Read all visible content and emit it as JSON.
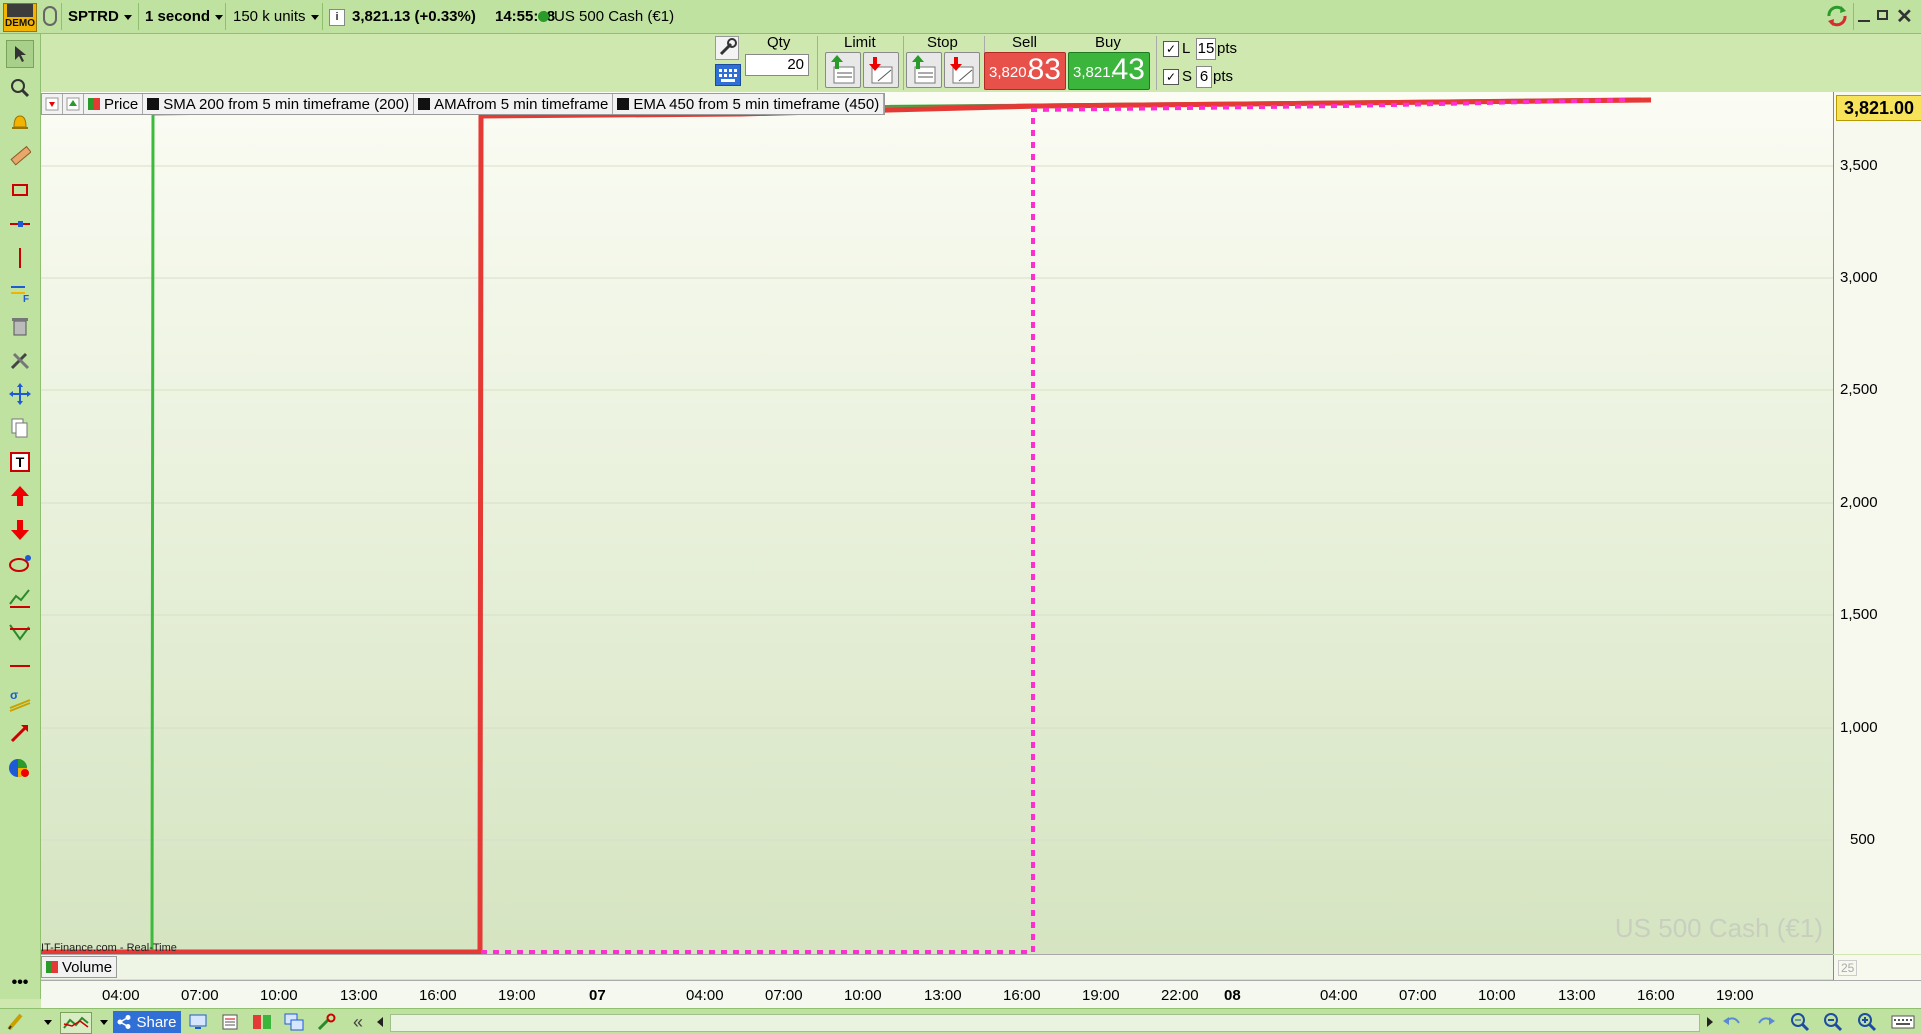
{
  "topbar": {
    "demo_label": "DEMO",
    "symbol": "SPTRD",
    "timeframe": "1 second",
    "units": "150 k units",
    "info_icon": "info-icon",
    "quote": "3,821.13 (+0.33%)",
    "time": "14:55:48",
    "instrument": "US 500 Cash (€1)"
  },
  "order_panel": {
    "qty_label": "Qty",
    "qty_value": "20",
    "limit_label": "Limit",
    "stop_label": "Stop",
    "sell_label": "Sell",
    "sell_small": "3,820.",
    "sell_big": "83",
    "buy_label": "Buy",
    "buy_small": "3,821.",
    "buy_big": "43",
    "l_label": "L",
    "l_value": "15",
    "s_label": "S",
    "s_value": "6",
    "pts_label": "pts",
    "colors": {
      "sell": "#e8504a",
      "buy": "#3cb53c"
    }
  },
  "legend": {
    "price": "Price",
    "sma": "SMA 200 from 5 min timeframe (200)",
    "ama": "AMAfrom 5 min timeframe",
    "ema": "EMA 450 from 5 min timeframe (450)"
  },
  "chart": {
    "price_tag": "3,821.00",
    "watermark": "US 500 Cash (€1)",
    "source": "IT-Finance.com - Real-Time",
    "y_ticks": [
      "3,500",
      "3,000",
      "2,500",
      "2,000",
      "1,500",
      "1,000",
      "500"
    ],
    "volume_label": "Volume",
    "volume_value": "25",
    "x_ticks": [
      "04:00",
      "07:00",
      "10:00",
      "13:00",
      "16:00",
      "19:00",
      "07",
      "04:00",
      "07:00",
      "10:00",
      "13:00",
      "16:00",
      "19:00",
      "22:00",
      "08",
      "04:00",
      "07:00",
      "10:00",
      "13:00",
      "16:00",
      "19:00"
    ],
    "colors": {
      "sma": "#3cba3c",
      "ema": "#e53935",
      "ama": "#ff2ed1"
    }
  },
  "bottombar": {
    "share_label": "Share"
  }
}
